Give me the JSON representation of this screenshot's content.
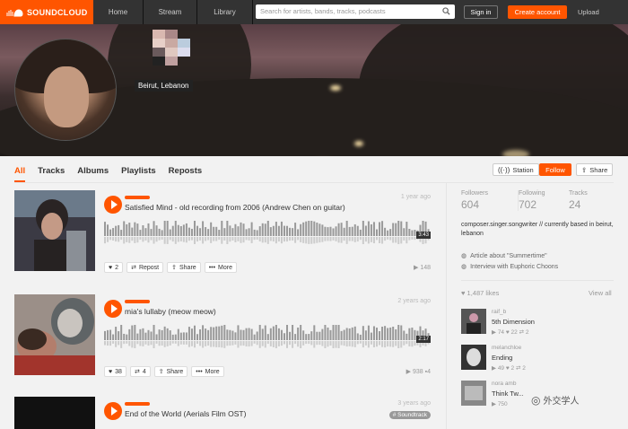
{
  "header": {
    "brand": "SOUNDCLOUD",
    "nav": [
      "Home",
      "Stream",
      "Library"
    ],
    "search_placeholder": "Search for artists, bands, tracks, podcasts",
    "signin": "Sign in",
    "create": "Create account",
    "upload": "Upload"
  },
  "profile": {
    "location": "Beirut, Lebanon"
  },
  "tabs": [
    "All",
    "Tracks",
    "Albums",
    "Playlists",
    "Reposts"
  ],
  "actions": {
    "station": "Station",
    "follow": "Follow",
    "share": "Share"
  },
  "tracks": [
    {
      "title": "Satisfied Mind - old recording from 2006 (Andrew Chen on guitar)",
      "time": "1 year ago",
      "duration": "3:43",
      "likes": "2",
      "repost": "Repost",
      "share": "Share",
      "more": "More",
      "plays": "148"
    },
    {
      "title": "mia's lullaby (meow meow)",
      "time": "2 years ago",
      "duration": "2:17",
      "likes": "38",
      "reposts": "4",
      "share": "Share",
      "more": "More",
      "plays": "938",
      "comments": "4"
    },
    {
      "title": "End of the World (Aerials Film OST)",
      "time": "3 years ago",
      "tag": "# Soundtrack"
    }
  ],
  "sidebar": {
    "stats": [
      {
        "label": "Followers",
        "value": "604"
      },
      {
        "label": "Following",
        "value": "702"
      },
      {
        "label": "Tracks",
        "value": "24"
      }
    ],
    "bio": "composer.singer.songwriter // currently based in beirut, lebanon",
    "links": [
      "Article about \"Summertime\"",
      "Interview with Euphoric Choons"
    ],
    "likes_count": "1,487 likes",
    "view_all": "View all",
    "liked": [
      {
        "user": "raif_b",
        "title": "5th Dimension",
        "plays": "74",
        "likes": "22",
        "reposts": "2"
      },
      {
        "user": "melanchloe",
        "title": "Ending",
        "plays": "49",
        "likes": "2",
        "reposts": "2"
      },
      {
        "user": "nora amb",
        "title": "Think Tw...",
        "plays": "750"
      }
    ]
  },
  "watermark": "外交学人",
  "colors": {
    "accent": "#ff5500",
    "topbar": "#333333"
  }
}
